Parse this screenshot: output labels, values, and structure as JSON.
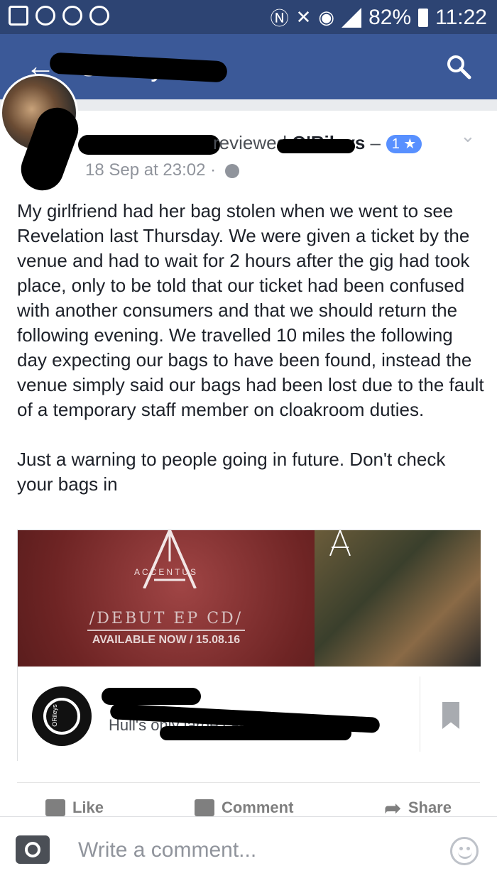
{
  "status": {
    "battery": "82%",
    "time": "11:22"
  },
  "appbar": {
    "title": "O'Rileys"
  },
  "review": {
    "verb": "reviewed",
    "place": "O'Rileys",
    "rating": "1 ★",
    "timestamp": "18 Sep at 23:02 ·",
    "text": "My girlfriend had her bag stolen when we went to see Revelation last Thursday. We were given a ticket by the venue and had to wait for 2 hours after the gig had took place, only to be told that our ticket had been confused with another consumers and that we should return the following evening. We travelled 10 miles the following day expecting our bags to have been found, instead the venue simply said our bags had been lost due to the fault of a temporary staff member on cloakroom duties.\n\nJust a warning to people going in future. Don't check your bags in"
  },
  "link_card": {
    "banner_brand": "ACCENTUS",
    "banner_ep": "/DEBUT EP CD/",
    "banner_available": "AVAILABLE NOW / 15.08.16",
    "avatar_label": "ORileys",
    "description": "Hull's only large capacity ... ...t..."
  },
  "actions": {
    "like": "Like",
    "comment": "Comment",
    "share": "Share"
  },
  "composer": {
    "placeholder": "Write a comment..."
  }
}
